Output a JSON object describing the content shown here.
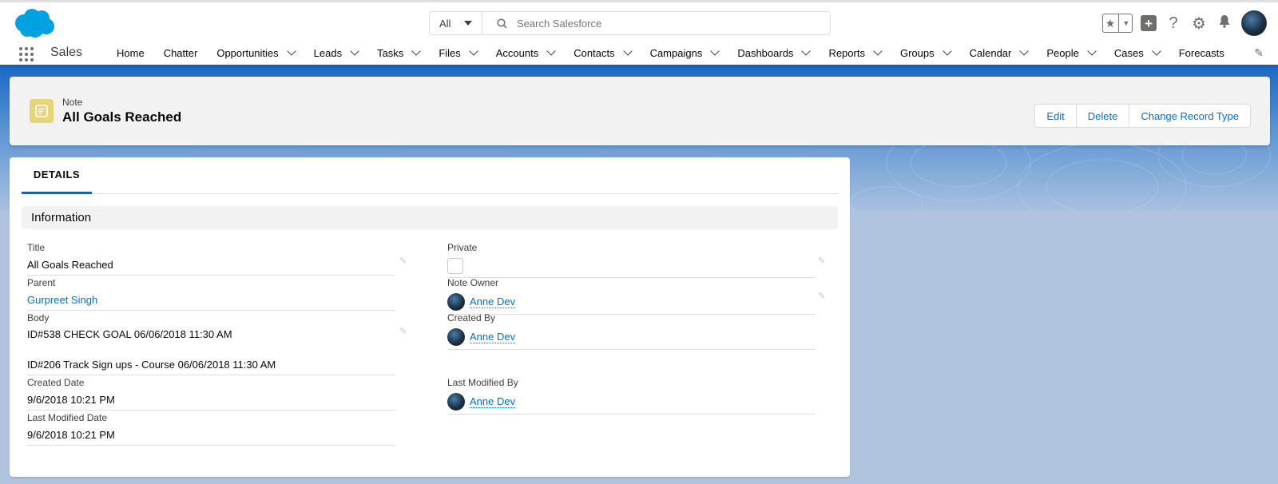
{
  "header": {
    "search_scope": "All",
    "search_placeholder": "Search Salesforce",
    "icons": [
      "salesforce-cloud-logo",
      "star-icon",
      "plus-icon",
      "help-icon",
      "gear-icon",
      "bell-icon",
      "avatar"
    ]
  },
  "nav": {
    "app_name": "Sales",
    "items": [
      {
        "label": "Home",
        "dropdown": false
      },
      {
        "label": "Chatter",
        "dropdown": false
      },
      {
        "label": "Opportunities",
        "dropdown": true
      },
      {
        "label": "Leads",
        "dropdown": true
      },
      {
        "label": "Tasks",
        "dropdown": true
      },
      {
        "label": "Files",
        "dropdown": true
      },
      {
        "label": "Accounts",
        "dropdown": true
      },
      {
        "label": "Contacts",
        "dropdown": true
      },
      {
        "label": "Campaigns",
        "dropdown": true
      },
      {
        "label": "Dashboards",
        "dropdown": true
      },
      {
        "label": "Reports",
        "dropdown": true
      },
      {
        "label": "Groups",
        "dropdown": true
      },
      {
        "label": "Calendar",
        "dropdown": true
      },
      {
        "label": "People",
        "dropdown": true
      },
      {
        "label": "Cases",
        "dropdown": true
      },
      {
        "label": "Forecasts",
        "dropdown": false
      }
    ]
  },
  "record": {
    "type_label": "Note",
    "title": "All Goals Reached",
    "actions": [
      "Edit",
      "Delete",
      "Change Record Type"
    ]
  },
  "details": {
    "tab_label": "DETAILS",
    "section_title": "Information",
    "fields": {
      "title": {
        "label": "Title",
        "value": "All Goals Reached"
      },
      "parent": {
        "label": "Parent",
        "value": "Gurpreet Singh"
      },
      "body": {
        "label": "Body",
        "line1": "ID#538 CHECK GOAL 06/06/2018 11:30 AM",
        "line2": "ID#206 Track Sign ups - Course 06/06/2018 11:30 AM"
      },
      "created_date": {
        "label": "Created Date",
        "value": "9/6/2018 10:21 PM"
      },
      "last_modified_date": {
        "label": "Last Modified Date",
        "value": "9/6/2018 10:21 PM"
      },
      "private": {
        "label": "Private",
        "checked": false
      },
      "note_owner": {
        "label": "Note Owner",
        "value": "Anne Dev"
      },
      "created_by": {
        "label": "Created By",
        "value": "Anne Dev"
      },
      "last_modified_by": {
        "label": "Last Modified By",
        "value": "Anne Dev"
      }
    }
  },
  "colors": {
    "brand_blue": "#1b5fb5",
    "link_blue": "#0070d2",
    "note_icon": "#e6d478"
  }
}
